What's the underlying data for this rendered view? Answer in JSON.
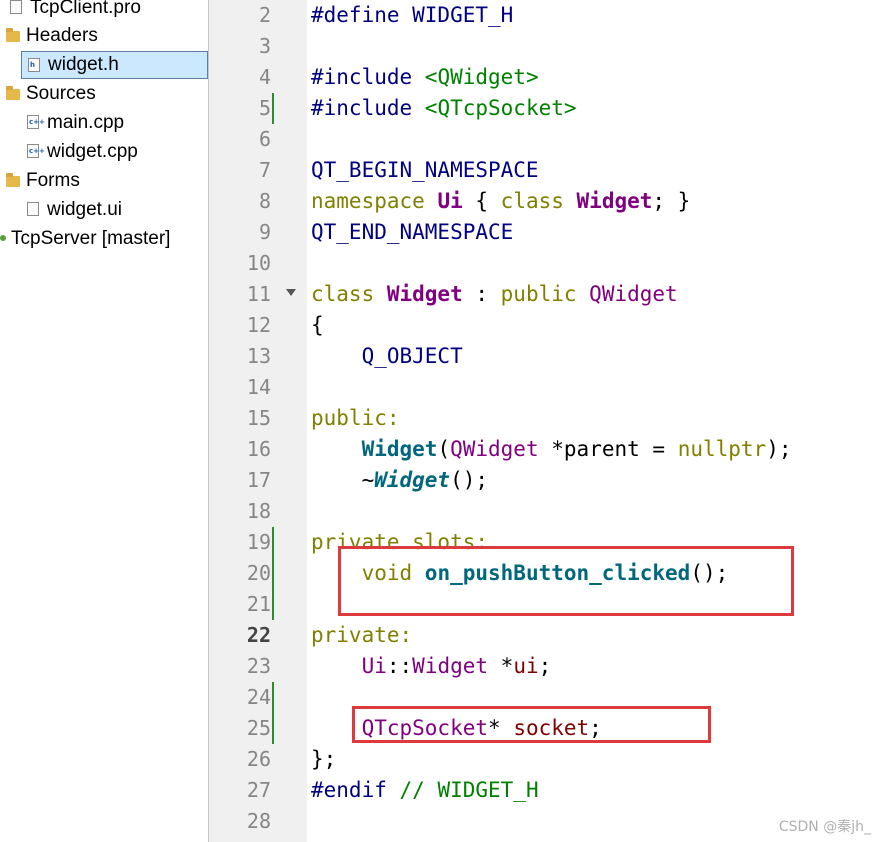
{
  "project_tree": {
    "items": [
      {
        "label": "TcpClient.pro",
        "icon": "pro-file-icon",
        "kind": "file"
      },
      {
        "label": "Headers",
        "icon": "headers-folder-icon",
        "kind": "folder"
      },
      {
        "label": "widget.h",
        "icon": "header-file-icon",
        "kind": "file",
        "selected": true
      },
      {
        "label": "Sources",
        "icon": "sources-folder-icon",
        "kind": "folder"
      },
      {
        "label": "main.cpp",
        "icon": "cpp-file-icon",
        "kind": "file"
      },
      {
        "label": "widget.cpp",
        "icon": "cpp-file-icon",
        "kind": "file"
      },
      {
        "label": "Forms",
        "icon": "forms-folder-icon",
        "kind": "folder"
      },
      {
        "label": "widget.ui",
        "icon": "ui-file-icon",
        "kind": "file"
      },
      {
        "label": "TcpServer [master]",
        "icon": "project-icon",
        "kind": "project"
      }
    ]
  },
  "editor": {
    "current_line": 22,
    "line_numbers": [
      2,
      3,
      4,
      5,
      6,
      7,
      8,
      9,
      10,
      11,
      12,
      13,
      14,
      15,
      16,
      17,
      18,
      19,
      20,
      21,
      22,
      23,
      24,
      25,
      26,
      27,
      28
    ],
    "lines": [
      [
        {
          "t": "#define WIDGET_H",
          "c": "pp"
        }
      ],
      [],
      [
        {
          "t": "#include ",
          "c": "pp"
        },
        {
          "t": "<QWidget>",
          "c": "inc"
        }
      ],
      [
        {
          "t": "#include ",
          "c": "pp"
        },
        {
          "t": "<QTcpSocket>",
          "c": "inc"
        }
      ],
      [],
      [
        {
          "t": "QT_BEGIN_NAMESPACE",
          "c": "mac"
        }
      ],
      [
        {
          "t": "namespace ",
          "c": "kw"
        },
        {
          "t": "Ui",
          "c": "tyb"
        },
        {
          "t": " { ",
          "c": "nm"
        },
        {
          "t": "class ",
          "c": "kw"
        },
        {
          "t": "Widget",
          "c": "tyb"
        },
        {
          "t": "; }",
          "c": "nm"
        }
      ],
      [
        {
          "t": "QT_END_NAMESPACE",
          "c": "mac"
        }
      ],
      [],
      [
        {
          "t": "class ",
          "c": "kw"
        },
        {
          "t": "Widget",
          "c": "tyb"
        },
        {
          "t": " : ",
          "c": "nm"
        },
        {
          "t": "public ",
          "c": "kw"
        },
        {
          "t": "QWidget",
          "c": "ty"
        }
      ],
      [
        {
          "t": "{",
          "c": "nm"
        }
      ],
      [
        {
          "t": "    ",
          "c": "nm"
        },
        {
          "t": "Q_OBJECT",
          "c": "mac"
        }
      ],
      [],
      [
        {
          "t": "public:",
          "c": "kw"
        }
      ],
      [
        {
          "t": "    ",
          "c": "nm"
        },
        {
          "t": "Widget",
          "c": "fn"
        },
        {
          "t": "(",
          "c": "nm"
        },
        {
          "t": "QWidget",
          "c": "ty"
        },
        {
          "t": " *",
          "c": "nm"
        },
        {
          "t": "parent",
          "c": "nm"
        },
        {
          "t": " = ",
          "c": "nm"
        },
        {
          "t": "nullptr",
          "c": "kw"
        },
        {
          "t": ");",
          "c": "nm"
        }
      ],
      [
        {
          "t": "    ~",
          "c": "nm"
        },
        {
          "t": "Widget",
          "c": "fni"
        },
        {
          "t": "();",
          "c": "nm"
        }
      ],
      [],
      [
        {
          "t": "private slots:",
          "c": "kw"
        }
      ],
      [
        {
          "t": "    ",
          "c": "nm"
        },
        {
          "t": "void ",
          "c": "kw"
        },
        {
          "t": "on_pushButton_clicked",
          "c": "fn"
        },
        {
          "t": "();",
          "c": "nm"
        }
      ],
      [],
      [
        {
          "t": "private:",
          "c": "kw"
        }
      ],
      [
        {
          "t": "    ",
          "c": "nm"
        },
        {
          "t": "Ui",
          "c": "ty"
        },
        {
          "t": "::",
          "c": "nm"
        },
        {
          "t": "Widget",
          "c": "ty"
        },
        {
          "t": " *",
          "c": "nm"
        },
        {
          "t": "ui",
          "c": "mem"
        },
        {
          "t": ";",
          "c": "nm"
        }
      ],
      [],
      [
        {
          "t": "    ",
          "c": "nm"
        },
        {
          "t": "QTcpSocket",
          "c": "ty"
        },
        {
          "t": "* ",
          "c": "nm"
        },
        {
          "t": "socket",
          "c": "mem"
        },
        {
          "t": ";",
          "c": "nm"
        }
      ],
      [
        {
          "t": "};",
          "c": "nm"
        }
      ],
      [
        {
          "t": "#endif ",
          "c": "pp"
        },
        {
          "t": "// WIDGET_H",
          "c": "cm"
        }
      ],
      []
    ],
    "modified_line_ranges": [
      [
        5,
        5
      ],
      [
        19,
        21
      ],
      [
        24,
        25
      ]
    ],
    "folded_line": 11
  },
  "colors": {
    "selection_bg": "#cce8ff",
    "gutter_bg": "#f0f0f0",
    "modified_marker": "#2e8b2e",
    "annotation_box": "#dd3a3e"
  },
  "annotations": [
    {
      "label": "highlight-slot-declaration",
      "lines": [
        19,
        21
      ]
    },
    {
      "label": "highlight-socket-member",
      "lines": [
        25,
        25
      ]
    }
  ],
  "watermark": "CSDN @秦jh_"
}
